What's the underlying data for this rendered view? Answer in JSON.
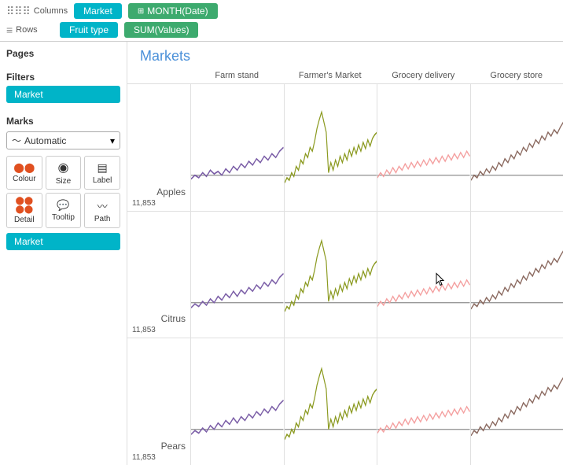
{
  "toolbar": {
    "columns_icon": "⠿",
    "columns_label": "Columns",
    "rows_icon": "≡",
    "rows_label": "Rows",
    "columns_pills": [
      {
        "label": "Market",
        "style": "pill-teal"
      },
      {
        "label": "MONTH(Date)",
        "style": "pill-green",
        "icon": "⊞"
      }
    ],
    "rows_pills": [
      {
        "label": "Fruit type",
        "style": "pill-teal"
      },
      {
        "label": "SUM(Values)",
        "style": "pill-green"
      }
    ]
  },
  "sidebar": {
    "pages_title": "Pages",
    "filters_title": "Filters",
    "filter_pill": "Market",
    "marks_title": "Marks",
    "marks_type": "Automatic",
    "marks_buttons": [
      {
        "label": "Colour",
        "icon": "⬤⬤"
      },
      {
        "label": "Size",
        "icon": "◉"
      },
      {
        "label": "Label",
        "icon": "▤"
      },
      {
        "label": "Detail",
        "icon": "⬤⬤"
      },
      {
        "label": "Tooltip",
        "icon": "💬"
      },
      {
        "label": "Path",
        "icon": "〜"
      }
    ],
    "marks_pill": "Market"
  },
  "chart": {
    "title": "Markets",
    "col_headers": [
      "Farm stand",
      "Farmer's Market",
      "Grocery delivery",
      "Grocery store"
    ],
    "rows": [
      {
        "label": "Apples",
        "value": "11,853",
        "charts": [
          {
            "color": "#7b5ea7",
            "type": "noisy-up"
          },
          {
            "color": "#8b9a20",
            "type": "noisy-spike"
          },
          {
            "color": "#f4a0a0",
            "type": "noisy-flat"
          },
          {
            "color": "#8b6a60",
            "type": "noisy-up"
          }
        ]
      },
      {
        "label": "Citrus",
        "value": "11,853",
        "charts": [
          {
            "color": "#7b5ea7",
            "type": "noisy-up"
          },
          {
            "color": "#8b9a20",
            "type": "noisy-spike"
          },
          {
            "color": "#f4a0a0",
            "type": "noisy-flat"
          },
          {
            "color": "#8b6a60",
            "type": "noisy-up"
          }
        ]
      },
      {
        "label": "Pears",
        "value": "11,853",
        "charts": [
          {
            "color": "#7b5ea7",
            "type": "noisy-up"
          },
          {
            "color": "#8b9a20",
            "type": "noisy-spike"
          },
          {
            "color": "#f4a0a0",
            "type": "noisy-flat"
          },
          {
            "color": "#8b6a60",
            "type": "noisy-up"
          }
        ]
      }
    ]
  }
}
